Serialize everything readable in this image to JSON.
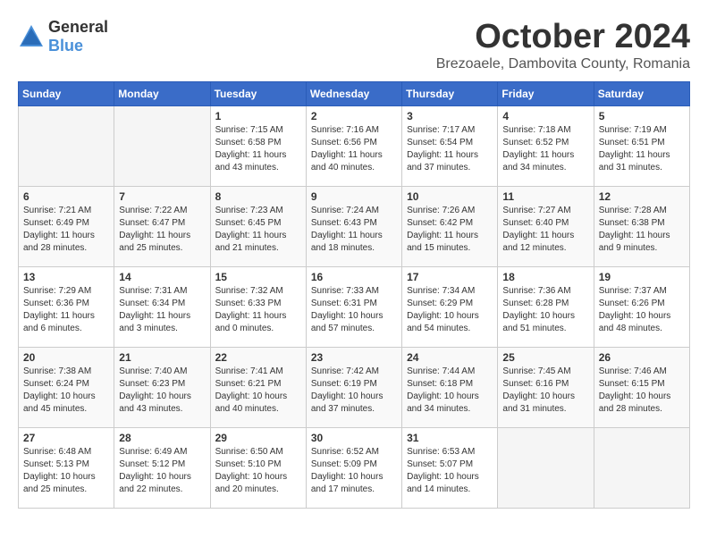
{
  "header": {
    "logo_general": "General",
    "logo_blue": "Blue",
    "month_title": "October 2024",
    "location": "Brezoaele, Dambovita County, Romania"
  },
  "days_of_week": [
    "Sunday",
    "Monday",
    "Tuesday",
    "Wednesday",
    "Thursday",
    "Friday",
    "Saturday"
  ],
  "weeks": [
    [
      {
        "day": "",
        "info": ""
      },
      {
        "day": "",
        "info": ""
      },
      {
        "day": "1",
        "info": "Sunrise: 7:15 AM\nSunset: 6:58 PM\nDaylight: 11 hours and 43 minutes."
      },
      {
        "day": "2",
        "info": "Sunrise: 7:16 AM\nSunset: 6:56 PM\nDaylight: 11 hours and 40 minutes."
      },
      {
        "day": "3",
        "info": "Sunrise: 7:17 AM\nSunset: 6:54 PM\nDaylight: 11 hours and 37 minutes."
      },
      {
        "day": "4",
        "info": "Sunrise: 7:18 AM\nSunset: 6:52 PM\nDaylight: 11 hours and 34 minutes."
      },
      {
        "day": "5",
        "info": "Sunrise: 7:19 AM\nSunset: 6:51 PM\nDaylight: 11 hours and 31 minutes."
      }
    ],
    [
      {
        "day": "6",
        "info": "Sunrise: 7:21 AM\nSunset: 6:49 PM\nDaylight: 11 hours and 28 minutes."
      },
      {
        "day": "7",
        "info": "Sunrise: 7:22 AM\nSunset: 6:47 PM\nDaylight: 11 hours and 25 minutes."
      },
      {
        "day": "8",
        "info": "Sunrise: 7:23 AM\nSunset: 6:45 PM\nDaylight: 11 hours and 21 minutes."
      },
      {
        "day": "9",
        "info": "Sunrise: 7:24 AM\nSunset: 6:43 PM\nDaylight: 11 hours and 18 minutes."
      },
      {
        "day": "10",
        "info": "Sunrise: 7:26 AM\nSunset: 6:42 PM\nDaylight: 11 hours and 15 minutes."
      },
      {
        "day": "11",
        "info": "Sunrise: 7:27 AM\nSunset: 6:40 PM\nDaylight: 11 hours and 12 minutes."
      },
      {
        "day": "12",
        "info": "Sunrise: 7:28 AM\nSunset: 6:38 PM\nDaylight: 11 hours and 9 minutes."
      }
    ],
    [
      {
        "day": "13",
        "info": "Sunrise: 7:29 AM\nSunset: 6:36 PM\nDaylight: 11 hours and 6 minutes."
      },
      {
        "day": "14",
        "info": "Sunrise: 7:31 AM\nSunset: 6:34 PM\nDaylight: 11 hours and 3 minutes."
      },
      {
        "day": "15",
        "info": "Sunrise: 7:32 AM\nSunset: 6:33 PM\nDaylight: 11 hours and 0 minutes."
      },
      {
        "day": "16",
        "info": "Sunrise: 7:33 AM\nSunset: 6:31 PM\nDaylight: 10 hours and 57 minutes."
      },
      {
        "day": "17",
        "info": "Sunrise: 7:34 AM\nSunset: 6:29 PM\nDaylight: 10 hours and 54 minutes."
      },
      {
        "day": "18",
        "info": "Sunrise: 7:36 AM\nSunset: 6:28 PM\nDaylight: 10 hours and 51 minutes."
      },
      {
        "day": "19",
        "info": "Sunrise: 7:37 AM\nSunset: 6:26 PM\nDaylight: 10 hours and 48 minutes."
      }
    ],
    [
      {
        "day": "20",
        "info": "Sunrise: 7:38 AM\nSunset: 6:24 PM\nDaylight: 10 hours and 45 minutes."
      },
      {
        "day": "21",
        "info": "Sunrise: 7:40 AM\nSunset: 6:23 PM\nDaylight: 10 hours and 43 minutes."
      },
      {
        "day": "22",
        "info": "Sunrise: 7:41 AM\nSunset: 6:21 PM\nDaylight: 10 hours and 40 minutes."
      },
      {
        "day": "23",
        "info": "Sunrise: 7:42 AM\nSunset: 6:19 PM\nDaylight: 10 hours and 37 minutes."
      },
      {
        "day": "24",
        "info": "Sunrise: 7:44 AM\nSunset: 6:18 PM\nDaylight: 10 hours and 34 minutes."
      },
      {
        "day": "25",
        "info": "Sunrise: 7:45 AM\nSunset: 6:16 PM\nDaylight: 10 hours and 31 minutes."
      },
      {
        "day": "26",
        "info": "Sunrise: 7:46 AM\nSunset: 6:15 PM\nDaylight: 10 hours and 28 minutes."
      }
    ],
    [
      {
        "day": "27",
        "info": "Sunrise: 6:48 AM\nSunset: 5:13 PM\nDaylight: 10 hours and 25 minutes."
      },
      {
        "day": "28",
        "info": "Sunrise: 6:49 AM\nSunset: 5:12 PM\nDaylight: 10 hours and 22 minutes."
      },
      {
        "day": "29",
        "info": "Sunrise: 6:50 AM\nSunset: 5:10 PM\nDaylight: 10 hours and 20 minutes."
      },
      {
        "day": "30",
        "info": "Sunrise: 6:52 AM\nSunset: 5:09 PM\nDaylight: 10 hours and 17 minutes."
      },
      {
        "day": "31",
        "info": "Sunrise: 6:53 AM\nSunset: 5:07 PM\nDaylight: 10 hours and 14 minutes."
      },
      {
        "day": "",
        "info": ""
      },
      {
        "day": "",
        "info": ""
      }
    ]
  ]
}
